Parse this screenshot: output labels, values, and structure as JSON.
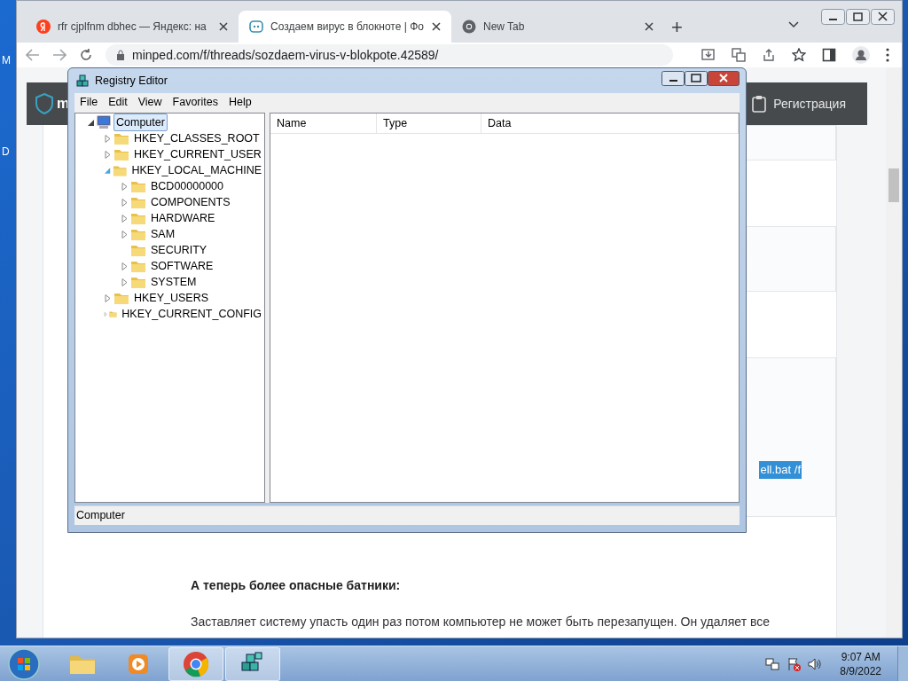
{
  "desktop_icon_labels": [
    "M",
    "D"
  ],
  "browser": {
    "tabs": [
      {
        "kind": "yandex",
        "title": "rfr cjplfnm dbhec — Яндекс: на",
        "selected": false
      },
      {
        "kind": "forum",
        "title": "Создаем вирус в блокноте | Фо",
        "selected": true
      },
      {
        "kind": "chrome",
        "title": "New Tab",
        "selected": false
      }
    ],
    "new_tab": "+",
    "url": "minped.com/f/threads/sozdaem-virus-v-blokpote.42589/",
    "page": {
      "logo_text": "m",
      "register_button": "Регистрация",
      "selected_text": "ell.bat /f",
      "heading": "А теперь более опасные батники:",
      "paragraph": "Заставляет систему упасть один раз потом компьютер не может быть перезапущен. Он удаляет все"
    }
  },
  "registry_editor": {
    "title": "Registry Editor",
    "menu": [
      "File",
      "Edit",
      "View",
      "Favorites",
      "Help"
    ],
    "tree": [
      {
        "label": "Computer",
        "selected": true,
        "expandable": true,
        "expanded": true,
        "children": [
          {
            "label": "HKEY_CLASSES_ROOT",
            "selected": false,
            "expandable": true,
            "expanded": false
          },
          {
            "label": "HKEY_CURRENT_USER",
            "selected": false,
            "expandable": true,
            "expanded": false
          },
          {
            "label": "HKEY_LOCAL_MACHINE",
            "selected": false,
            "expandable": true,
            "expanded": true,
            "children": [
              {
                "label": "BCD00000000",
                "selected": false,
                "expandable": true,
                "expanded": false
              },
              {
                "label": "COMPONENTS",
                "selected": false,
                "expandable": true,
                "expanded": false
              },
              {
                "label": "HARDWARE",
                "selected": false,
                "expandable": true,
                "expanded": false
              },
              {
                "label": "SAM",
                "selected": false,
                "expandable": true,
                "expanded": false
              },
              {
                "label": "SECURITY",
                "selected": false,
                "expandable": false,
                "expanded": false
              },
              {
                "label": "SOFTWARE",
                "selected": false,
                "expandable": true,
                "expanded": false
              },
              {
                "label": "SYSTEM",
                "selected": false,
                "expandable": true,
                "expanded": false
              }
            ]
          },
          {
            "label": "HKEY_USERS",
            "selected": false,
            "expandable": true,
            "expanded": false
          },
          {
            "label": "HKEY_CURRENT_CONFIG",
            "selected": false,
            "expandable": true,
            "expanded": false
          }
        ]
      }
    ],
    "columns": [
      "Name",
      "Type",
      "Data"
    ],
    "status_bar": "Computer"
  },
  "taskbar": {
    "apps": [
      {
        "kind": "explorer",
        "active": false
      },
      {
        "kind": "media",
        "active": false
      },
      {
        "kind": "chrome",
        "active": true
      },
      {
        "kind": "regedit",
        "active": true
      }
    ],
    "time": "9:07 AM",
    "date": "8/9/2022"
  }
}
